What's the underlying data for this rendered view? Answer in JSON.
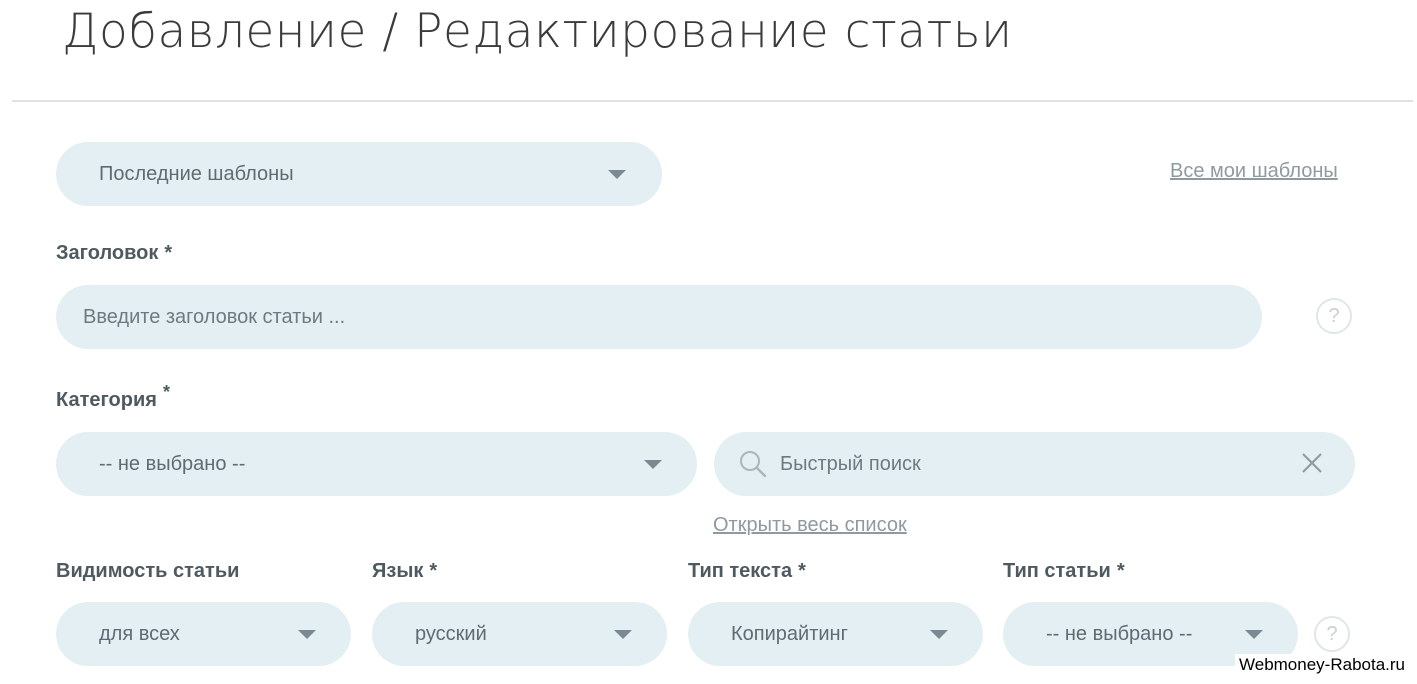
{
  "page": {
    "title": "Добавление / Редактирование статьи"
  },
  "templates": {
    "selected": "Последние шаблоны",
    "all_link": "Все мои шаблоны"
  },
  "title_field": {
    "label": "Заголовок",
    "required_mark": "*",
    "placeholder": "Введите заголовок статьи ...",
    "help": "?"
  },
  "category": {
    "label": "Категория",
    "required_mark": "*",
    "selected": "-- не выбрано --",
    "search_placeholder": "Быстрый поиск",
    "open_list_link": "Открыть весь список"
  },
  "visibility": {
    "label": "Видимость статьи",
    "selected": "для всех"
  },
  "language": {
    "label": "Язык",
    "required_mark": "*",
    "selected": "русский"
  },
  "text_type": {
    "label": "Тип текста",
    "required_mark": "*",
    "selected": "Копирайтинг"
  },
  "article_type": {
    "label": "Тип статьи",
    "required_mark": "*",
    "selected": "-- не выбрано --",
    "help": "?"
  },
  "watermark": "Webmoney-Rabota.ru",
  "colors": {
    "field_bg": "#e4eff3",
    "link": "#8e9aa0",
    "label": "#4e5a60"
  }
}
